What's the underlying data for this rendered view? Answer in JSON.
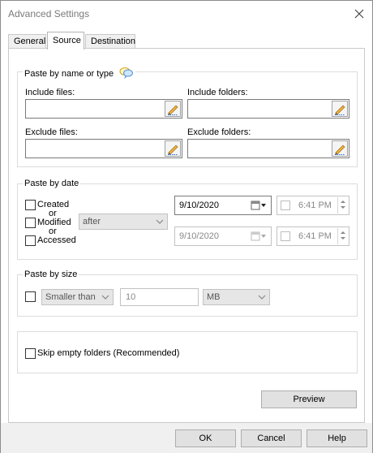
{
  "window": {
    "title": "Advanced Settings",
    "close_icon": "close-icon"
  },
  "tabs": [
    {
      "label": "General",
      "active": false
    },
    {
      "label": "Source",
      "active": true
    },
    {
      "label": "Destination",
      "active": false
    }
  ],
  "paste_by_name": {
    "title": "Paste by name or type",
    "help_icon": "speech-bubbles-icon",
    "include_files": {
      "label": "Include files:",
      "value": ""
    },
    "include_folders": {
      "label": "Include folders:",
      "value": ""
    },
    "exclude_files": {
      "label": "Exclude files:",
      "value": ""
    },
    "exclude_folders": {
      "label": "Exclude folders:",
      "value": ""
    },
    "edit_icon": "pencil-icon"
  },
  "paste_by_date": {
    "title": "Paste by date",
    "created": {
      "label": "Created",
      "checked": false
    },
    "or1": "or",
    "modified": {
      "label": "Modified",
      "checked": false
    },
    "or2": "or",
    "accessed": {
      "label": "Accessed",
      "checked": false
    },
    "condition": "after",
    "date1": "9/10/2020",
    "time1": "6:41 PM",
    "date2": "9/10/2020",
    "time2": "6:41 PM"
  },
  "paste_by_size": {
    "title": "Paste by size",
    "enabled": false,
    "comparison": "Smaller than",
    "value": "10",
    "unit": "MB"
  },
  "skip_empty_folders": {
    "label": "Skip empty folders (Recommended)",
    "checked": false
  },
  "buttons": {
    "preview": "Preview",
    "ok": "OK",
    "cancel": "Cancel",
    "help": "Help"
  },
  "colors": {
    "disabled_bg": "#e6e6e6",
    "footer_bg": "#f0f0f0",
    "border": "#7a7a7a"
  }
}
